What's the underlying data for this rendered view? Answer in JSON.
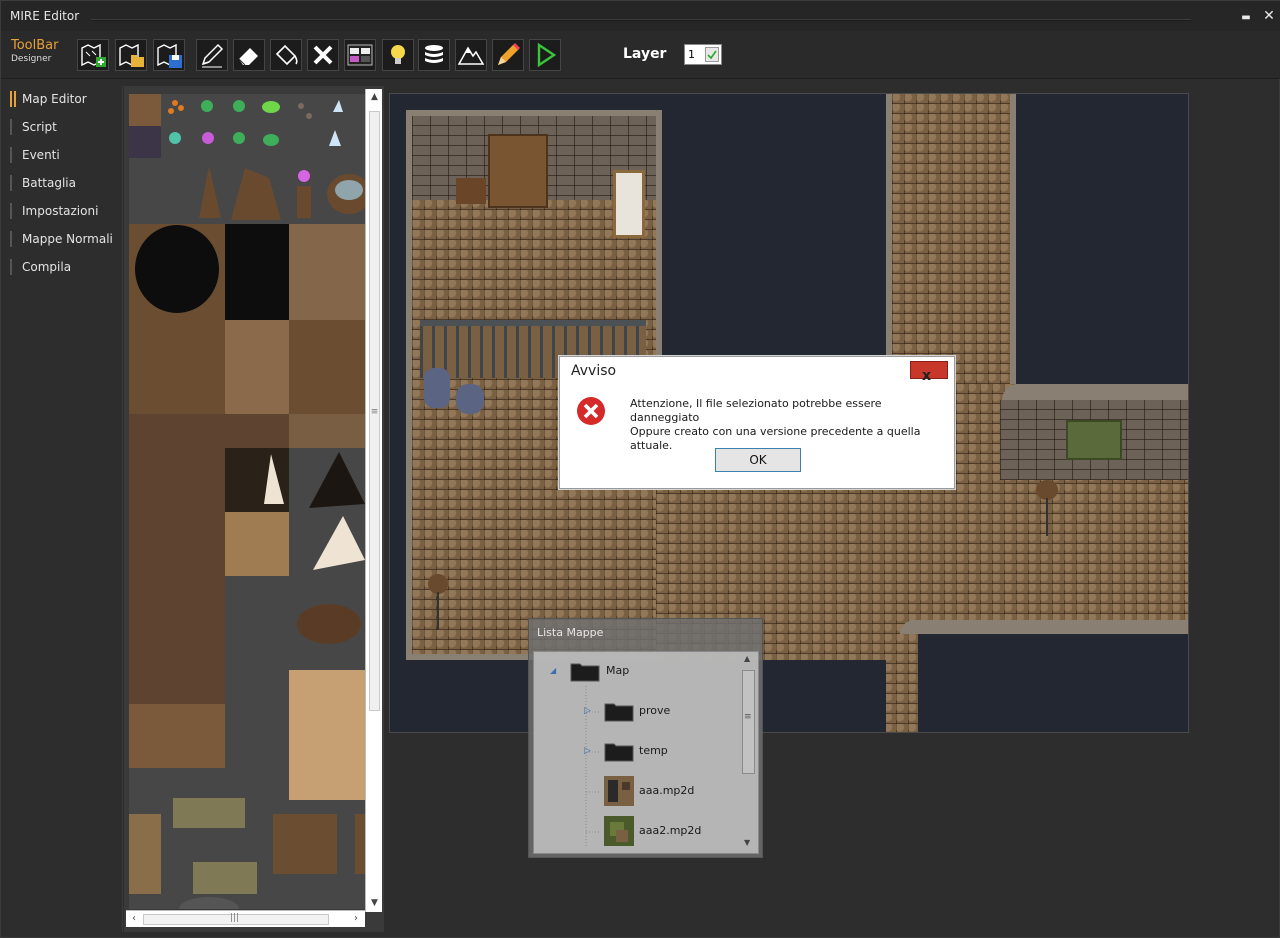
{
  "window": {
    "title": "MIRE Editor",
    "minimize_glyph": "▬",
    "close_glyph": "✕"
  },
  "toolbar": {
    "brand_line1": "ToolBar",
    "brand_line2": "Designer",
    "layer_label": "Layer",
    "layer_value": "1",
    "tools": [
      "new-map-icon",
      "open-map-icon",
      "save-map-icon",
      "pencil-icon",
      "eraser-icon",
      "fill-bucket-icon",
      "delete-icon",
      "tileset-icon",
      "lightbulb-icon",
      "database-icon",
      "mountain-icon",
      "edit-pencil-icon",
      "play-icon"
    ]
  },
  "sidebar": {
    "items": [
      {
        "label": "Map Editor",
        "active": true
      },
      {
        "label": "Script",
        "active": false
      },
      {
        "label": "Eventi",
        "active": false
      },
      {
        "label": "Battaglia",
        "active": false
      },
      {
        "label": "Impostazioni",
        "active": false
      },
      {
        "label": "Mappe Normali",
        "active": false
      },
      {
        "label": "Compila",
        "active": false
      }
    ]
  },
  "palette": {
    "scroll_up": "▲",
    "scroll_down": "▼",
    "scroll_left": "‹",
    "scroll_right": "›",
    "grip": "≡",
    "hgrip": "|||"
  },
  "dialog": {
    "title": "Avviso",
    "close_glyph": "x",
    "message_line1": "Attenzione, Il file selezionato potrebbe essere danneggiato",
    "message_line2": "Oppure creato con una versione precedente a quella attuale.",
    "ok_label": "OK",
    "icon": "error-icon"
  },
  "map_list": {
    "title": "Lista Mappe",
    "items": [
      {
        "label": "Map",
        "type": "folder",
        "expanded": true
      },
      {
        "label": "prove",
        "type": "folder",
        "expanded": false
      },
      {
        "label": "temp",
        "type": "folder",
        "expanded": false
      },
      {
        "label": "aaa.mp2d",
        "type": "file"
      },
      {
        "label": "aaa2.mp2d",
        "type": "file"
      }
    ]
  },
  "colors": {
    "accent": "#e7a23a",
    "error_red": "#c7382b",
    "background": "#2d2d2d",
    "map_void": "#232732"
  }
}
